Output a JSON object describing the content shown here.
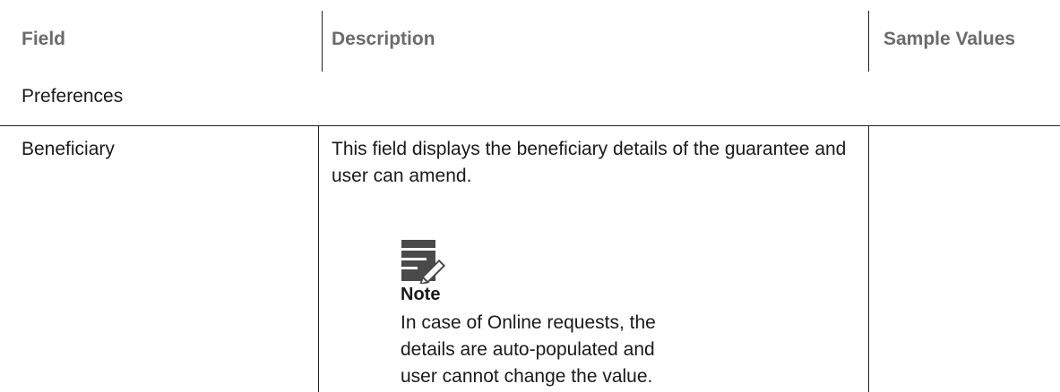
{
  "table": {
    "headers": {
      "field": "Field",
      "description": "Description",
      "sample_values": "Sample Values"
    },
    "section_label": "Preferences",
    "row": {
      "field": "Beneficiary",
      "description": "This field displays the beneficiary details of the guarantee and user can amend.",
      "note": {
        "icon": "note-icon",
        "title": "Note",
        "text": "In case of Online requests, the details are auto-populated and user cannot change the value."
      },
      "sample_value": ""
    }
  }
}
